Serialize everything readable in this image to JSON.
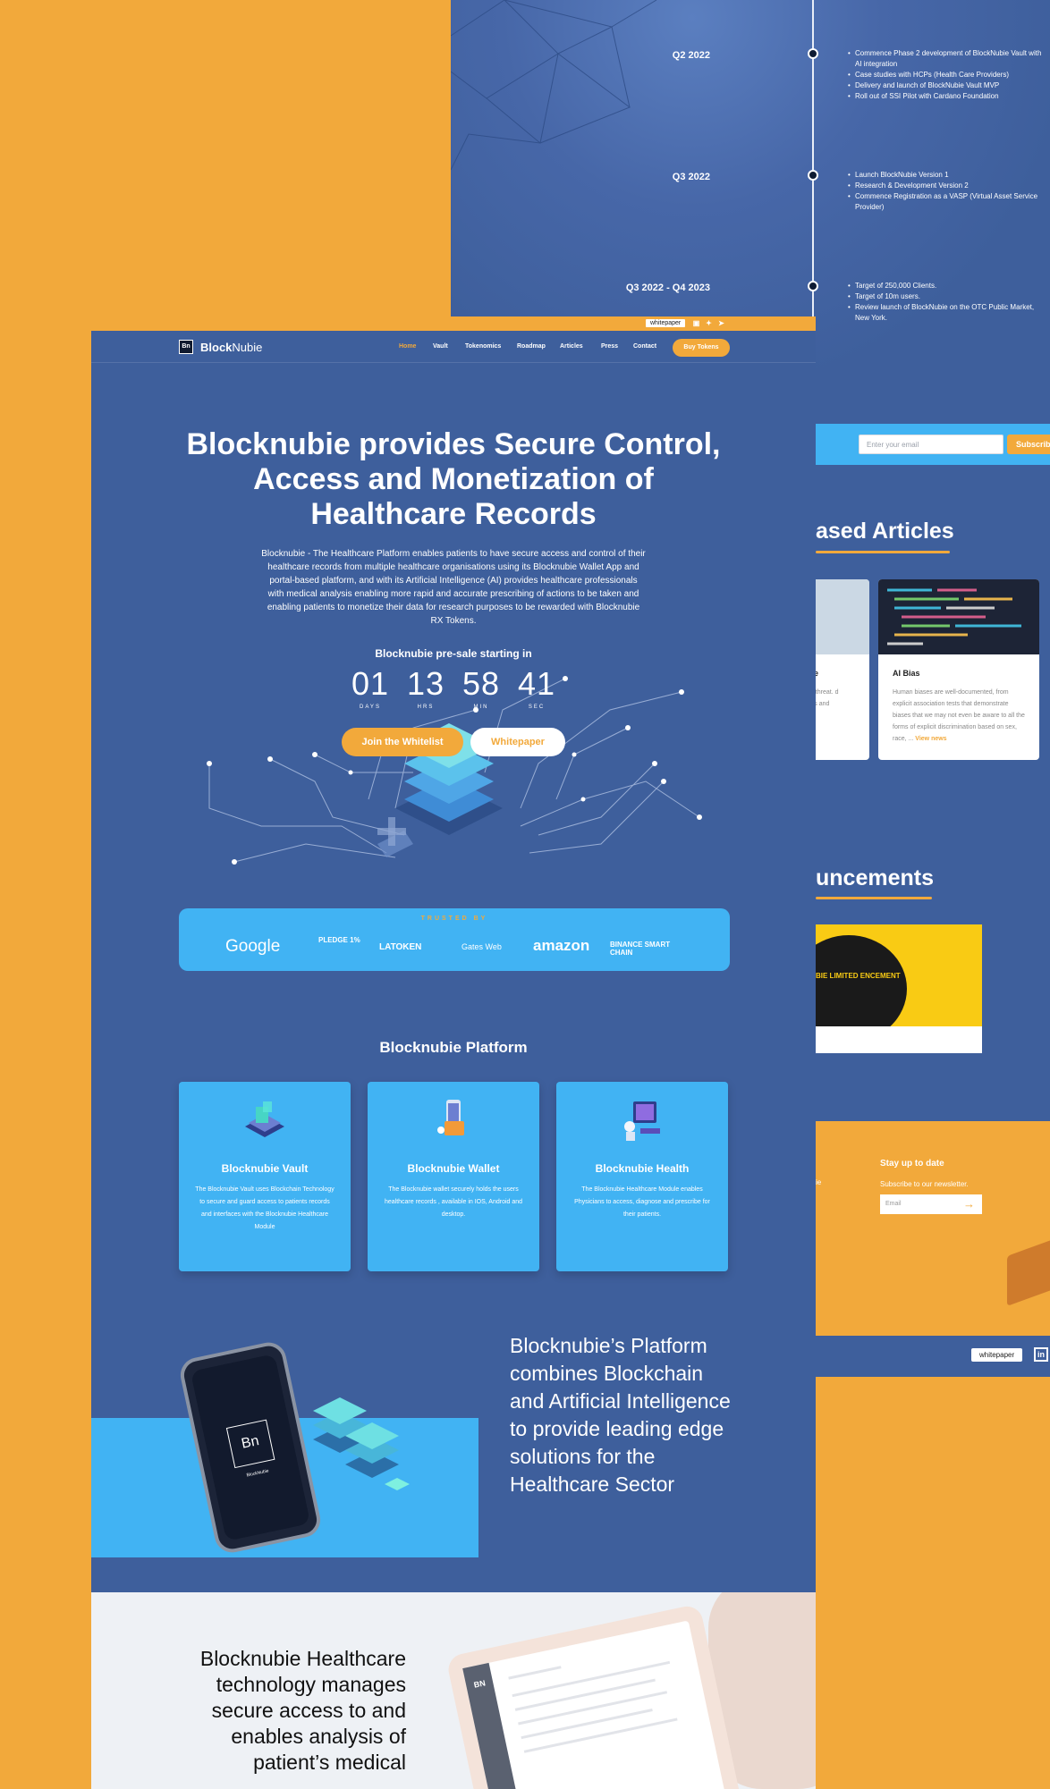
{
  "back": {
    "roadmap": [
      {
        "label": "Q2 2022",
        "items": [
          "Commence Phase 2 development of BlockNubie Vault with AI integration",
          "Case studies with HCPs (Health Care Providers)",
          "Delivery and launch of BlockNubie Vault MVP",
          "Roll out of SSI Pilot with Cardano Foundation"
        ]
      },
      {
        "label": "Q3 2022",
        "items": [
          "Launch BlockNubie Version 1",
          "Research & Development Version 2",
          "Commence Registration as a VASP (Virtual Asset Service Provider)"
        ]
      },
      {
        "label": "Q3 2022 - Q4 2023",
        "items": [
          "Target of 250,000 Clients.",
          "Target of 10m users.",
          "Review launch of BlockNubie on the OTC Public Market, New York."
        ]
      }
    ],
    "newsletter": {
      "placeholder": "Enter your email",
      "button": "Subscribe"
    },
    "articles_heading": "ased Articles",
    "articles": [
      {
        "title": "als in the",
        "desc": "s an also a threat. d changing es and"
      },
      {
        "title": "AI Bias",
        "desc": "Human biases are well-documented, from explicit association tests that demonstrate biases that we may not even be aware to all the forms of explicit discrimination based on sex, race, ...",
        "more": "View news"
      }
    ],
    "announcements_heading": "uncements",
    "announcement_image_text": "BIE LIMITED ENCEMENT",
    "footer": {
      "stay_title": "Stay up to date",
      "stay_sub": "Subscribe to our newsletter.",
      "email_placeholder": "Email",
      "left_fragment": "ie",
      "whitepaper": "whitepaper",
      "linkedin": "in"
    }
  },
  "front": {
    "topbar": {
      "whitepaper": "whitepaper",
      "socials": [
        "linkedin-icon",
        "twitter-icon",
        "telegram-icon"
      ]
    },
    "logo": {
      "badge": "Bn",
      "bold": "Block",
      "light": "Nubie"
    },
    "nav": [
      "Home",
      "Vault",
      "Tokenomics",
      "Roadmap",
      "Articles",
      "Press",
      "Contact"
    ],
    "buy_tokens": "Buy Tokens",
    "hero": {
      "title_lines": [
        "Blocknubie provides Secure Control,",
        "Access and Monetization of",
        "Healthcare Records"
      ],
      "description": "Blocknubie - The Healthcare Platform enables patients to have secure access and control of their healthcare records from multiple healthcare organisations using its Blocknubie Wallet App and portal-based platform, and with its Artificial Intelligence (AI) provides healthcare professionals with medical analysis enabling more rapid and accurate prescribing of actions to be taken and enabling patients to monetize their data for research purposes to be rewarded with Blocknubie RX Tokens.",
      "presale": "Blocknubie pre-sale starting in",
      "countdown": [
        {
          "value": "01",
          "label": "DAYS"
        },
        {
          "value": "13",
          "label": "HRS"
        },
        {
          "value": "58",
          "label": "MIN"
        },
        {
          "value": "41",
          "label": "SEC"
        }
      ],
      "join_whitelist": "Join the Whitelist",
      "whitepaper": "Whitepaper"
    },
    "trusted": {
      "label": "TRUSTED BY",
      "logos": [
        "Google",
        "PLEDGE 1%",
        "LATOKEN",
        "Gates Web",
        "amazon",
        "BINANCE SMART CHAIN"
      ]
    },
    "platform": {
      "title": "Blocknubie Platform",
      "cards": [
        {
          "title": "Blocknubie Vault",
          "desc": "The Blocknubie Vault uses Blockchain Technology to secure and guard access to patients records and interfaces with the Blocknubie Healthcare Module",
          "icon": "vault-icon"
        },
        {
          "title": "Blocknubie Wallet",
          "desc": "The Blocknubie wallet securely holds the users healthcare records , available in IOS, Android and desktop.",
          "icon": "wallet-icon"
        },
        {
          "title": "Blocknubie Health",
          "desc": "The Blocknubie Healthcare Module enables Physicians to access, diagnose and prescribe for their patients.",
          "icon": "health-icon"
        }
      ]
    },
    "combines": "Blocknubie’s Platform combines Blockchain and Artificial Intelligence to provide leading edge solutions for the Healthcare Sector",
    "phone": {
      "badge": "Bn",
      "sub": "BlockNubie"
    },
    "bottom": {
      "text": "Blocknubie Healthcare technology manages secure access to and enables analysis of patient’s medical",
      "tablet_badge": "BN"
    }
  },
  "colors": {
    "orange": "#F2A93B",
    "navy": "#3E5F9C",
    "sky": "#41B3F3"
  }
}
